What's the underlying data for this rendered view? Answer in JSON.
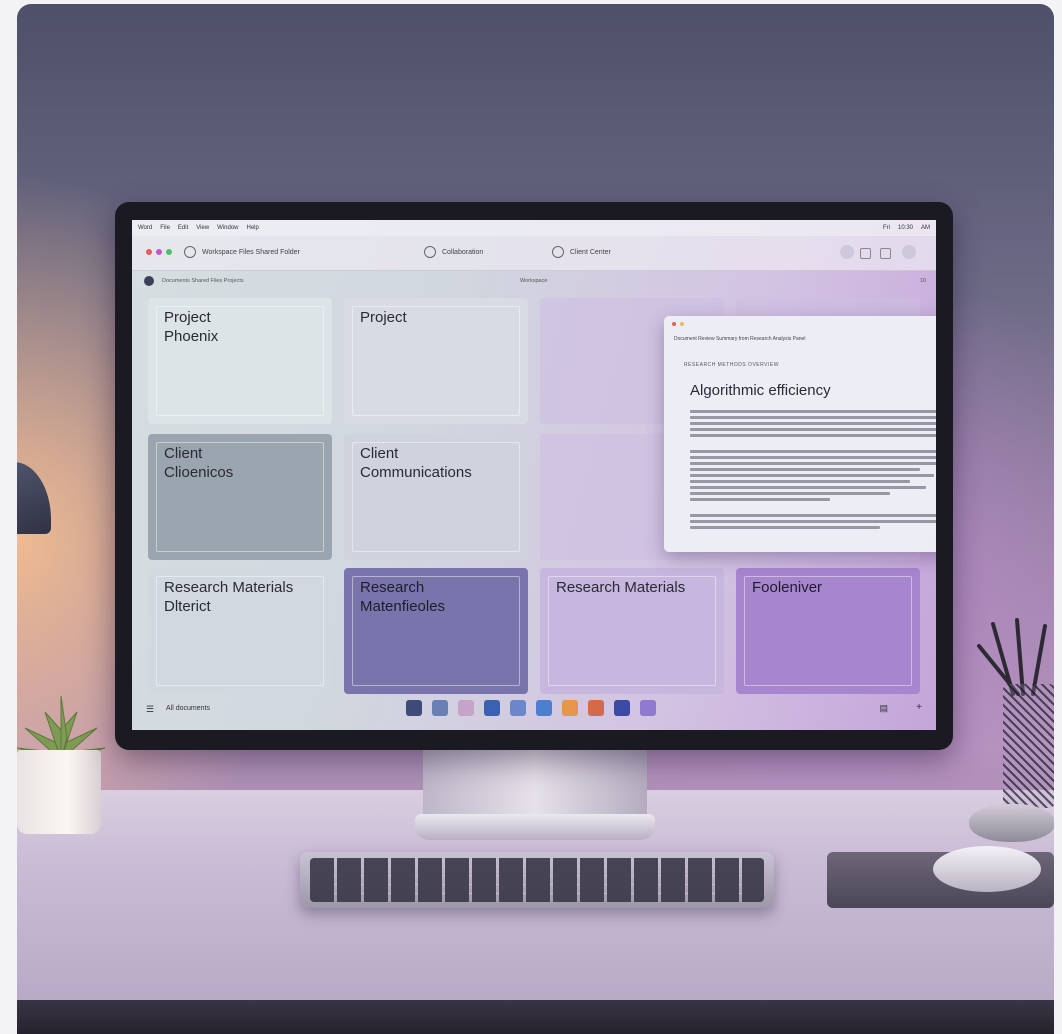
{
  "monitor": {
    "menubar": {
      "left_items": [
        "Word",
        "File",
        "Edit",
        "View",
        "Window",
        "Help"
      ],
      "right_items": [
        "Fri",
        "10:30",
        "AM"
      ]
    },
    "toolbar": {
      "window_title": "Workspace Files Shared Folder",
      "tabs": [
        "Collaboration",
        "Client Center"
      ]
    },
    "pathbar": {
      "left": "Documents  Shared Files  Projects",
      "center": "Workspace",
      "right": "10"
    },
    "tiles": [
      {
        "label": "Project\nPhoenix",
        "color": "#dde4e5"
      },
      {
        "label": "Project",
        "color": "#d8dbe4"
      },
      {
        "label": "Client\nClioenicos",
        "color": "#9ba5af"
      },
      {
        "label": "Client\nCommunications",
        "color": "#cfd3de"
      },
      {
        "label": "Research Materials\nDlterict",
        "color": "#d2d8e0"
      },
      {
        "label": "Research\nMatenfieoles",
        "color": "#7a74ad"
      },
      {
        "label": "Research Materials",
        "color": "#c7b6dd"
      },
      {
        "label": "Fooleniver",
        "color": "#a886cf"
      }
    ],
    "dialog": {
      "header": "Document Review Summary from Research Analysis Panel",
      "subheader": "RESEARCH METHODS OVERVIEW",
      "title": "Algorithmic efficiency"
    },
    "dock": {
      "left_label": "All documents",
      "icon_colors": [
        "#3f4a78",
        "#6a7fb4",
        "#c6a4c9",
        "#3c61b3",
        "#6b86c9",
        "#4d7fd0",
        "#e7944d",
        "#d46a4a",
        "#3b4aa5",
        "#8f7ad0"
      ]
    },
    "accent_color": "#8f6fd2"
  }
}
